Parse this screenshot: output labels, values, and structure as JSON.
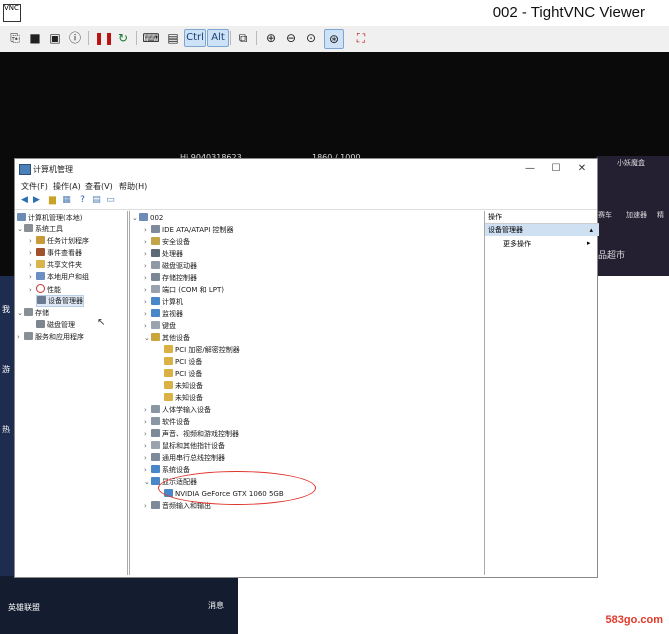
{
  "vnc": {
    "title": "002 - TightVNC Viewer",
    "icon_text": "VNC"
  },
  "desktop": {
    "hud_name": "Hi  9040318623",
    "hud_level": "1860 / 1000",
    "right_user": "小妖魔盒",
    "right_tabs": [
      "赛车",
      "加速器",
      "精"
    ],
    "right_text": "品超市",
    "left_items": [
      "我",
      "游",
      "热"
    ],
    "bottom_labels": [
      "英雄联盟",
      "消息"
    ],
    "watermark": "583go.com"
  },
  "cm": {
    "title": "计算机管理",
    "controls": [
      "—",
      "☐",
      "✕"
    ],
    "menu": [
      "文件(F)",
      "操作(A)",
      "查看(V)",
      "帮助(H)"
    ]
  },
  "tree": {
    "root": "计算机管理(本地)",
    "system_tools": "系统工具",
    "items": [
      "任务计划程序",
      "事件查看器",
      "共享文件夹",
      "本地用户和组",
      "性能",
      "设备管理器"
    ],
    "storage": "存储",
    "storage_items": [
      "磁盘管理"
    ],
    "services": "服务和应用程序"
  },
  "devices": {
    "root": "002",
    "list": [
      "IDE ATA/ATAPI 控制器",
      "安全设备",
      "处理器",
      "磁盘驱动器",
      "存储控制器",
      "端口 (COM 和 LPT)",
      "计算机",
      "监视器",
      "键盘",
      "其他设备",
      "PCI 加密/解密控制器",
      "PCI 设备",
      "PCI 设备",
      "未知设备",
      "未知设备",
      "人体学输入设备",
      "软件设备",
      "声音、视频和游戏控制器",
      "鼠标和其他指针设备",
      "通用串行总线控制器",
      "系统设备",
      "显示适配器",
      "NVIDIA GeForce GTX 1060 5GB",
      "音频输入和输出"
    ]
  },
  "actions": {
    "header": "操作",
    "group": "设备管理器",
    "more": "更多操作"
  }
}
